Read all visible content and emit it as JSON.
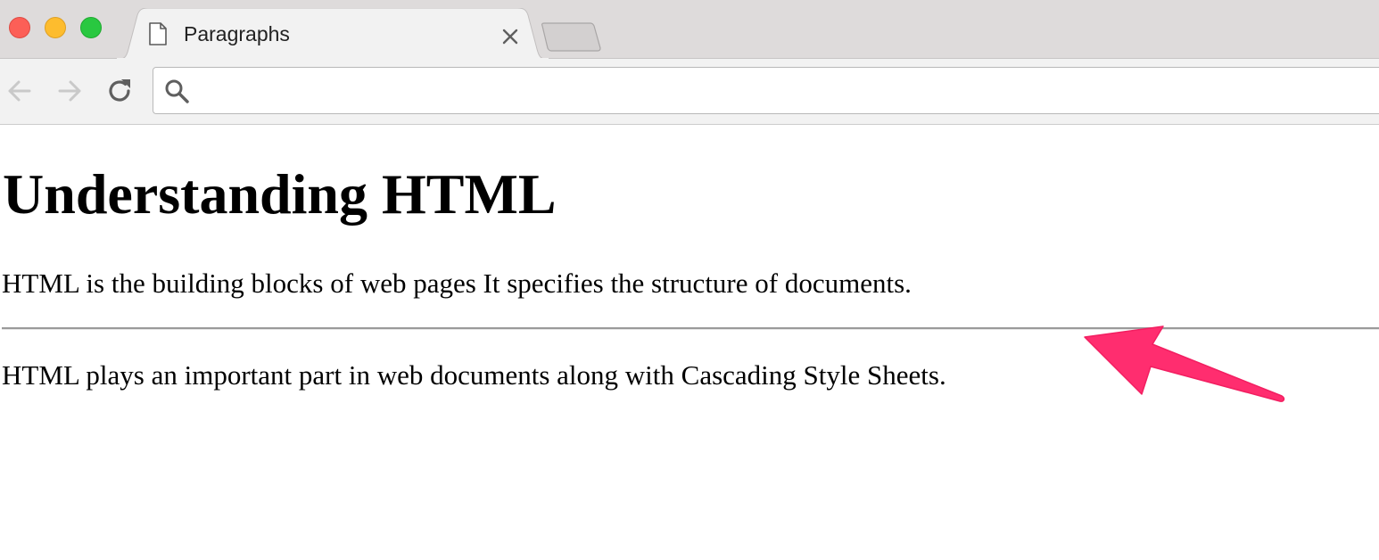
{
  "browser": {
    "tab": {
      "title": "Paragraphs",
      "favicon_icon": "document-icon",
      "close_icon": "close-icon"
    },
    "new_tab_icon": "new-tab-icon",
    "toolbar": {
      "back_icon": "back-arrow-icon",
      "forward_icon": "forward-arrow-icon",
      "reload_icon": "reload-icon",
      "omnibox": {
        "search_icon": "search-icon",
        "value": ""
      }
    },
    "window_controls": [
      "close",
      "minimize",
      "maximize"
    ]
  },
  "page": {
    "heading": "Understanding HTML",
    "paragraph_1": "HTML is the building blocks of web pages It specifies the structure of documents.",
    "paragraph_2": "HTML plays an important part in web documents along with Cascading Style Sheets."
  },
  "annotation": {
    "arrow_icon": "pointer-arrow-icon",
    "arrow_color": "#ff2d6f"
  },
  "colors": {
    "tabstrip": "#dedbdb",
    "toolbar": "#f2f2f2",
    "traffic_close": "#fc5f57",
    "traffic_minimize": "#fdbc2e",
    "traffic_maximize": "#29c840",
    "rule": "#9a9a9a"
  }
}
